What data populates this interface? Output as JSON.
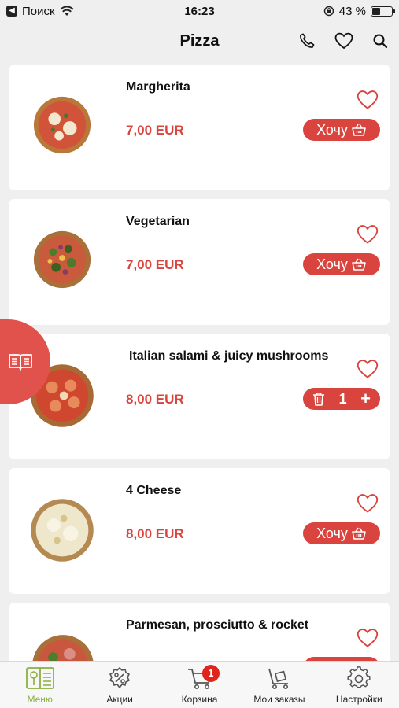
{
  "status_bar": {
    "back_label": "Поиск",
    "time": "16:23",
    "battery": "43 %",
    "battery_level": 0.43
  },
  "header": {
    "title": "Pizza",
    "icons": [
      "phone-icon",
      "heart-icon",
      "search-icon"
    ]
  },
  "colors": {
    "accent": "#d9443e",
    "tab_active": "#8bb03f",
    "badge": "#e0241c"
  },
  "products": [
    {
      "name": "Margherita",
      "price": "7,00 EUR",
      "action_label": "Хочу"
    },
    {
      "name": "Vegetarian",
      "price": "7,00 EUR",
      "action_label": "Хочу"
    },
    {
      "name": "Italian salami & juicy mushrooms",
      "price": "8,00 EUR",
      "quantity": "1"
    },
    {
      "name": "4 Cheese",
      "price": "8,00 EUR",
      "action_label": "Хочу"
    },
    {
      "name": "Parmesan, prosciutto & rocket"
    }
  ],
  "tabbar": {
    "items": [
      {
        "label": "Меню",
        "icon": "menu-book-icon",
        "active": true
      },
      {
        "label": "Акции",
        "icon": "discount-icon"
      },
      {
        "label": "Корзина",
        "icon": "cart-icon",
        "badge": "1"
      },
      {
        "label": "Мои заказы",
        "icon": "orders-trolley-icon"
      },
      {
        "label": "Настройки",
        "icon": "gear-icon"
      }
    ]
  }
}
